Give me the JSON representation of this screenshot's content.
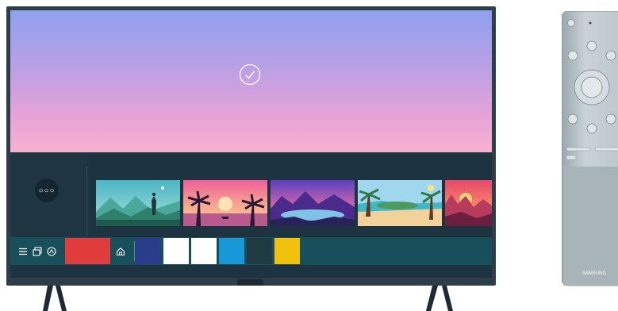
{
  "hero": {
    "text": ""
  },
  "side": {
    "more_glyph": "○○○",
    "label": ""
  },
  "row": {
    "title": ""
  },
  "remote": {
    "brand": "SAMSUNG"
  },
  "colors": {
    "bezel": "#2d3e4a",
    "screen_panel": "#1d3440",
    "taskbar": "#17505b",
    "tiles": [
      "#e03c3c",
      "#2a3d8c",
      "#ffffff",
      "#ffffff",
      "#1998d8",
      "#203a44",
      "#f2c10e"
    ]
  },
  "icons": {
    "hero": "check-circle-icon",
    "taskbar": [
      "menu-icon",
      "sources-icon",
      "ambient-icon",
      "home-icon"
    ]
  }
}
